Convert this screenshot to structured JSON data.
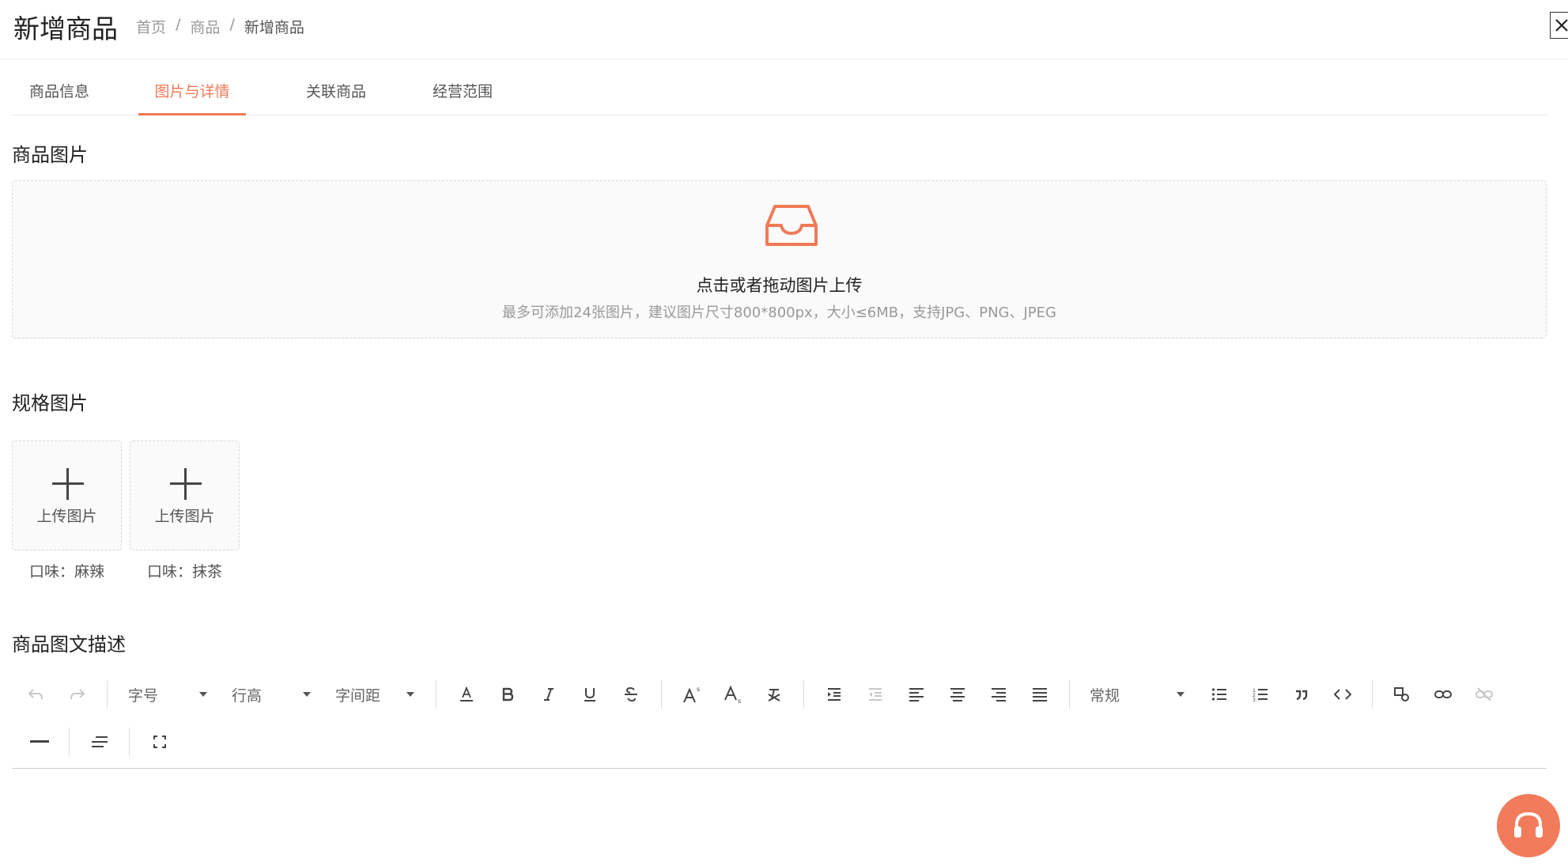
{
  "header": {
    "title": "新增商品",
    "breadcrumb": [
      "首页",
      "商品",
      "新增商品"
    ],
    "breadcrumb_separator": "/",
    "close_icon": "close-icon"
  },
  "tabs": [
    {
      "label": "商品信息",
      "active": false
    },
    {
      "label": "图片与详情",
      "active": true
    },
    {
      "label": "关联商品",
      "active": false
    },
    {
      "label": "经营范围",
      "active": false
    }
  ],
  "product_images": {
    "title": "商品图片",
    "upload_text": "点击或者拖动图片上传",
    "upload_hint": "最多可添加24张图片，建议图片尺寸800*800px，大小≤6MB，支持JPG、PNG、JPEG",
    "icon": "inbox-icon"
  },
  "spec_images": {
    "title": "规格图片",
    "items": [
      {
        "upload_label": "上传图片",
        "caption": "口味：麻辣"
      },
      {
        "upload_label": "上传图片",
        "caption": "口味：抹茶"
      }
    ]
  },
  "description": {
    "title": "商品图文描述",
    "toolbar": {
      "font_size": "字号",
      "line_height": "行高",
      "letter_spacing": "字间距",
      "block_type": "常规"
    }
  },
  "colors": {
    "accent": "#f07a57",
    "help_button": "#f27b5b"
  }
}
